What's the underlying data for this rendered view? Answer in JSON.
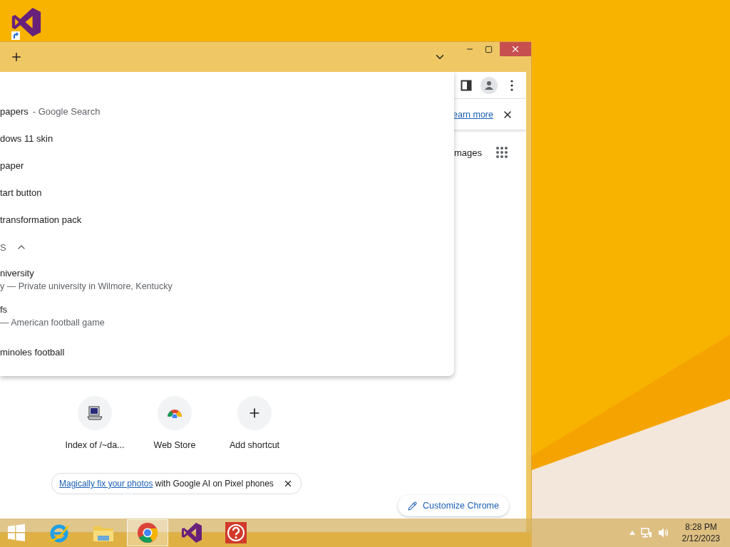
{
  "browser": {
    "suggestions": [
      {
        "text": "papers",
        "suffix": "- Google Search"
      },
      {
        "text": "dows 11 skin"
      },
      {
        "text": "paper"
      },
      {
        "text": "tart button"
      },
      {
        "text": "transformation pack"
      }
    ],
    "trending": {
      "title": "S",
      "expanded": true,
      "items": [
        {
          "title": "niversity",
          "subtitle": "y — Private university in Wilmore, Kentucky"
        },
        {
          "title": "fs",
          "subtitle": "— American football game"
        },
        {
          "title": "minoles football"
        }
      ]
    },
    "info_bar": {
      "link": "earn more"
    },
    "header_link": "mages",
    "shortcuts": [
      {
        "kind": "site",
        "label": "Index of /~da..."
      },
      {
        "kind": "store",
        "label": "Web Store"
      },
      {
        "kind": "add",
        "label": "Add shortcut"
      }
    ],
    "promo": {
      "link": "Magically fix your photos",
      "text": "with Google AI on Pixel phones"
    },
    "customize": {
      "label": "Customize Chrome"
    }
  },
  "taskbar": {
    "apps": [
      {
        "kind": "ie",
        "selected": false
      },
      {
        "kind": "explorer",
        "selected": false
      },
      {
        "kind": "chrome",
        "selected": true
      },
      {
        "kind": "vs",
        "selected": false
      },
      {
        "kind": "help",
        "selected": false
      }
    ],
    "clock": {
      "time": "8:28 PM",
      "date": "2/12/2023"
    }
  }
}
